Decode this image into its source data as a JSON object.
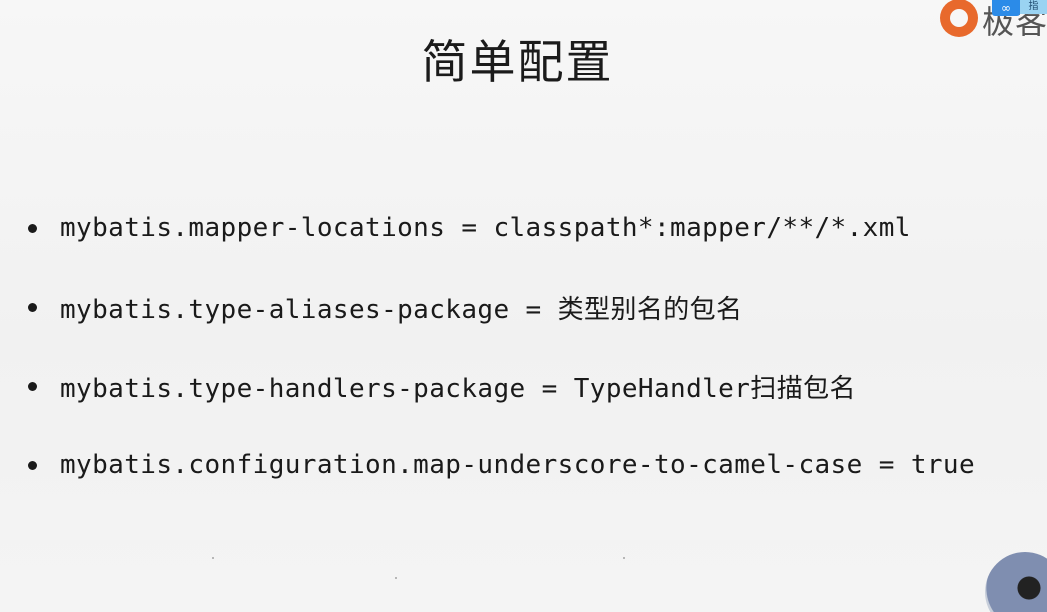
{
  "slide": {
    "title": "简单配置",
    "bullets": [
      "mybatis.mapper-locations = classpath*:mapper/**/*.xml",
      "mybatis.type-aliases-package = 类型别名的包名",
      "mybatis.type-handlers-package = TypeHandler扫描包名",
      "mybatis.configuration.map-underscore-to-camel-case = true"
    ]
  },
  "overlay": {
    "brand_text": "极客",
    "share_symbol": "∞",
    "share_tab_label": "指"
  },
  "colors": {
    "accent": "#e8692c",
    "share_blue": "#2b8be8",
    "share_tab_blue": "#9ad3f2",
    "text": "#1a1a1a",
    "background": "#f4f4f4"
  }
}
